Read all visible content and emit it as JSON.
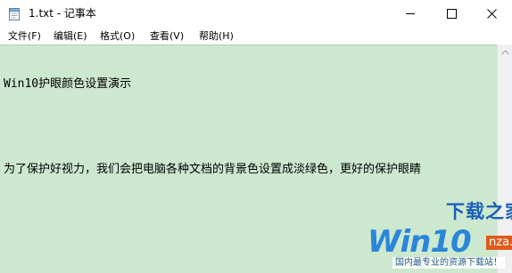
{
  "window": {
    "title": "1.txt - 记事本"
  },
  "menu": {
    "items": [
      {
        "label": "文件(F)"
      },
      {
        "label": "编辑(E)"
      },
      {
        "label": "格式(O)"
      },
      {
        "label": "查看(V)"
      },
      {
        "label": "帮助(H)"
      }
    ]
  },
  "editor": {
    "lines": [
      "Win10护眼颜色设置演示",
      "",
      "为了保护好视力，我们会把电脑各种文档的背景色设置成淡绿色，更好的保护眼睛"
    ],
    "background_color": "#cce8cf"
  },
  "watermark": {
    "brand": "下载之家",
    "logo": "Win10",
    "site": "nza.cn",
    "slogan": "国内最专业的资源下载站！"
  },
  "icons": {
    "app": "notepad-icon",
    "minimize": "minimize-icon",
    "maximize": "maximize-icon",
    "close": "close-icon",
    "scroll_up": "scroll-up-arrow-icon"
  }
}
